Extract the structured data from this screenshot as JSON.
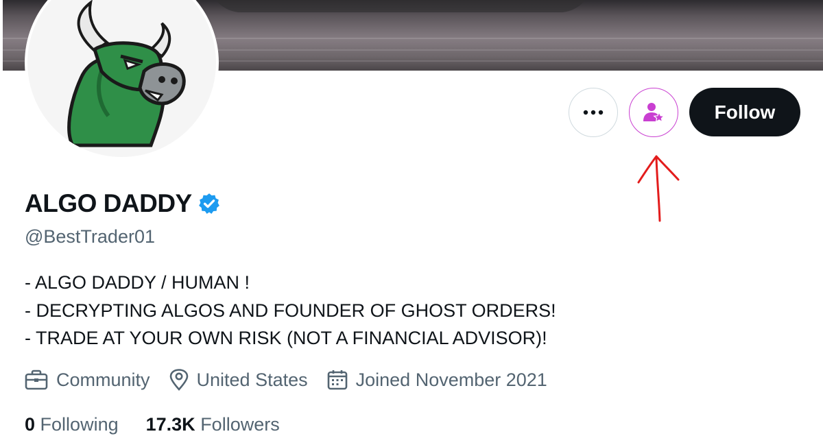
{
  "profile": {
    "display_name": "ALGO DADDY",
    "handle": "@BestTrader01",
    "bio": [
      "- ALGO DADDY / HUMAN !",
      "- DECRYPTING ALGOS AND FOUNDER OF GHOST ORDERS!",
      "- TRADE AT YOUR OWN RISK (NOT A FINANCIAL ADVISOR)!"
    ],
    "category": "Community",
    "location": "United States",
    "joined": "Joined November 2021",
    "following_count": "0",
    "following_label": "Following",
    "followers_count": "17.3K",
    "followers_label": "Followers"
  },
  "actions": {
    "more_icon": "more-dots-icon",
    "subscribe_icon": "person-star-icon",
    "follow_label": "Follow"
  },
  "colors": {
    "accent_subscribe": "#c93fd1",
    "verified_blue": "#1d9bf0",
    "annotation_red": "#e31c1c",
    "text_primary": "#0f1419",
    "text_secondary": "#536471"
  }
}
